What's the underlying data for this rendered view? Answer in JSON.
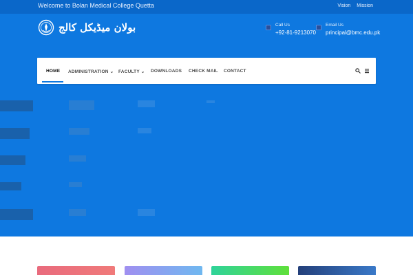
{
  "topbar": {
    "welcome": "Welcome to Bolan Medical College Quetta",
    "links": [
      "Vision",
      "Mission"
    ]
  },
  "logo": {
    "urdu_text": "بولان میڈیکل کالج",
    "emblem_icon": "college-emblem-icon"
  },
  "contact": {
    "call_label": "Call Us",
    "call_value": "+92-81-9213070",
    "email_label": "Email Us",
    "email_value": "principal@bmc.edu.pk",
    "phone_icon": "phone-icon",
    "mail_icon": "mail-icon"
  },
  "nav": {
    "home": "HOME",
    "administration": "ADMINISTRATION",
    "faculty": "FACULTY",
    "downloads": "DOWNLOADS",
    "check_mail": "CHECK MAIL",
    "contact": "CONTACT",
    "search_icon": "search-icon",
    "menu_icon": "menu-icon"
  },
  "colors": {
    "topbar": "#0a67c9",
    "hero": "#0e78e0",
    "card1": "#e8707a",
    "card2": "#8aa8f0",
    "card3": "#3ad46a",
    "card4": "#2b5aa6"
  }
}
